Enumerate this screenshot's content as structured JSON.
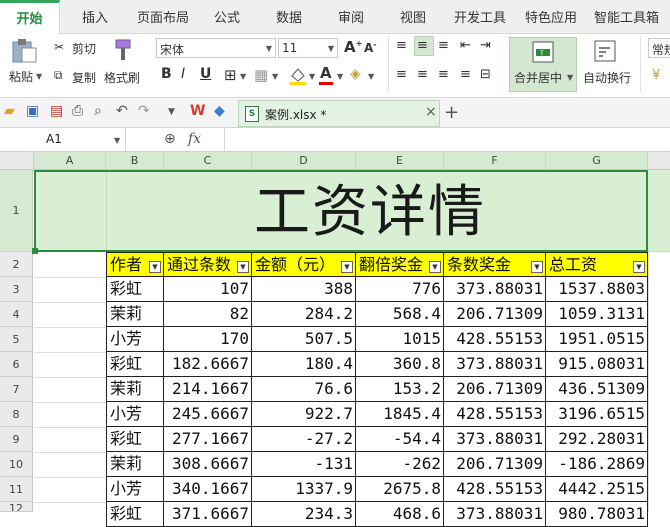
{
  "ribbon_tabs": [
    "开始",
    "插入",
    "页面布局",
    "公式",
    "数据",
    "审阅",
    "视图",
    "开发工具",
    "特色应用",
    "智能工具箱"
  ],
  "ribbon": {
    "paste_label": "粘贴",
    "cut_label": "剪切",
    "copy_label": "复制",
    "format_painter_label": "格式刷",
    "font_name": "宋体",
    "font_size": "11",
    "merge_center_label": "合并居中",
    "wrap_text_label": "自动换行",
    "regular_label": "常规"
  },
  "document_tab": {
    "name": "案例.xlsx *"
  },
  "formula_bar": {
    "name_box": "A1",
    "fx_label": "fx",
    "content": ""
  },
  "columns": [
    "A",
    "B",
    "C",
    "D",
    "E",
    "F",
    "G"
  ],
  "rows": [
    "1",
    "2",
    "3",
    "4",
    "5",
    "6",
    "7",
    "8",
    "9",
    "10",
    "11",
    "12"
  ],
  "sheet": {
    "title": "工资详情",
    "headers": [
      "作者",
      "通过条数",
      "金额（元）",
      "翻倍奖金",
      "条数奖金",
      "总工资"
    ],
    "data": [
      [
        "彩虹",
        "107",
        "388",
        "776",
        "373.88031",
        "1537.8803"
      ],
      [
        "茉莉",
        "82",
        "284.2",
        "568.4",
        "206.71309",
        "1059.3131"
      ],
      [
        "小芳",
        "170",
        "507.5",
        "1015",
        "428.55153",
        "1951.0515"
      ],
      [
        "彩虹",
        "182.6667",
        "180.4",
        "360.8",
        "373.88031",
        "915.08031"
      ],
      [
        "茉莉",
        "214.1667",
        "76.6",
        "153.2",
        "206.71309",
        "436.51309"
      ],
      [
        "小芳",
        "245.6667",
        "922.7",
        "1845.4",
        "428.55153",
        "3196.6515"
      ],
      [
        "彩虹",
        "277.1667",
        "-27.2",
        "-54.4",
        "373.88031",
        "292.28031"
      ],
      [
        "茉莉",
        "308.6667",
        "-131",
        "-262",
        "206.71309",
        "-186.2869"
      ],
      [
        "小芳",
        "340.1667",
        "1337.9",
        "2675.8",
        "428.55153",
        "4442.2515"
      ],
      [
        "彩虹",
        "371.6667",
        "234.3",
        "468.6",
        "373.88031",
        "980.78031"
      ]
    ]
  }
}
